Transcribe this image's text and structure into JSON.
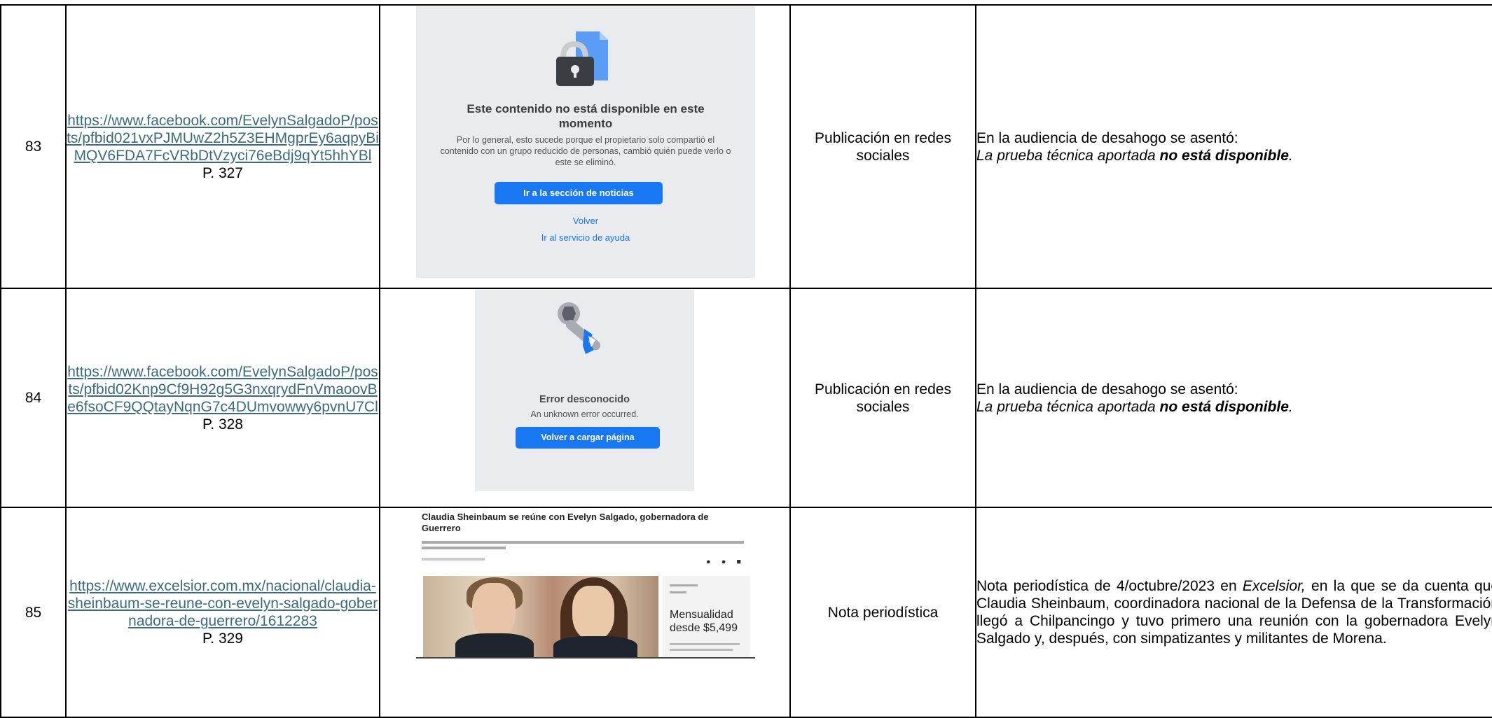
{
  "rows": [
    {
      "number": "83",
      "url": "https://www.facebook.com/EvelynSalgadoP/posts/pfbid021vxPJMUwZ2h5Z3EHMgprEy6aqpyBiMQV6FDA7FcVRbDtVzyci76eBdj9qYt5hhYBl",
      "page": "P. 327",
      "screenshot": {
        "title": "Este contenido no está disponible en este momento",
        "body": "Por lo general, esto sucede porque el propietario solo compartió el contenido con un grupo reducido de personas, cambió quién puede verlo o este se eliminó.",
        "button": "Ir a la sección de noticias",
        "link_back": "Volver",
        "link_help": "Ir al servicio de ayuda"
      },
      "type": "Publicación en redes sociales",
      "desc_intro": "En la audiencia de desahogo se asentó:",
      "desc_em_prefix": "La prueba técnica aportada ",
      "desc_em_strong": "no está disponible",
      "desc_em_suffix": "."
    },
    {
      "number": "84",
      "url": "https://www.facebook.com/EvelynSalgadoP/posts/pfbid02Knp9Cf9H92g5G3nxqrydFnVmaoovBe6fsoCF9QQtayNqnG7c4DUmvowwy6pvnU7Cl",
      "page": "P. 328",
      "screenshot": {
        "title": "Error desconocido",
        "subtitle": "An unknown error occurred.",
        "button": "Volver a cargar página"
      },
      "type": "Publicación en redes sociales",
      "desc_intro": "En la audiencia de desahogo se asentó:",
      "desc_em_prefix": "La prueba técnica aportada ",
      "desc_em_strong": "no está disponible",
      "desc_em_suffix": "."
    },
    {
      "number": "85",
      "url": "https://www.excelsior.com.mx/nacional/claudia-sheinbaum-se-reune-con-evelyn-salgado-gobernadora-de-guerrero/1612283",
      "page": "P. 329",
      "screenshot": {
        "headline": "Claudia Sheinbaum se reúne con Evelyn Salgado, gobernadora de Guerrero",
        "ad_text": "Mensualidad desde $5,499"
      },
      "type": "Nota periodística",
      "desc_part1": "Nota periodística de 4/octubre/2023 en ",
      "desc_em": "Excelsior,",
      "desc_part2": " en la que se da cuenta que Claudia Sheinbaum, coordinadora nacional de la Defensa de la Transformación llegó a Chilpancingo y tuvo primero una reunión con la gobernadora Evelyn Salgado y, después, con simpatizantes y militantes de Morena."
    }
  ]
}
